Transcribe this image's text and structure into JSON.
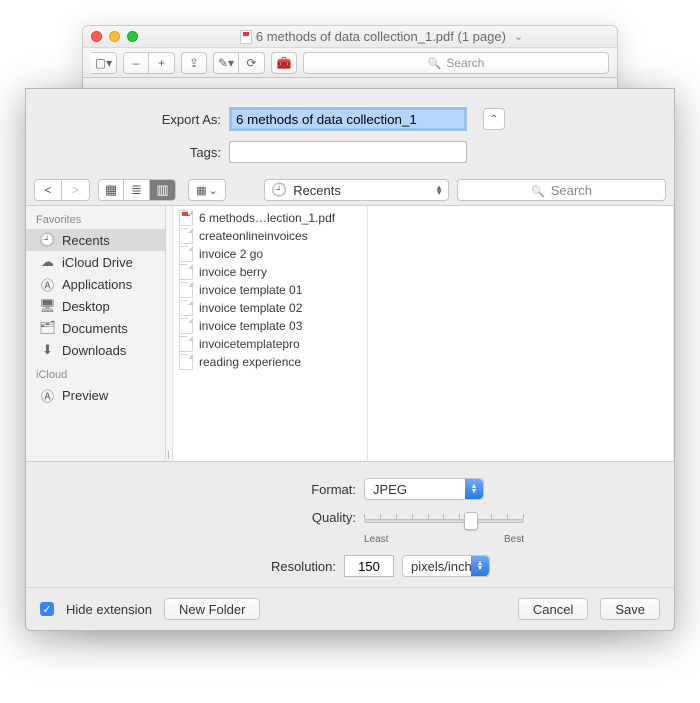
{
  "parent": {
    "title": "6 methods of data collection_1.pdf (1 page)",
    "search_placeholder": "Search"
  },
  "exportForm": {
    "exportLabel": "Export As:",
    "exportValue": "6 methods of data collection_1",
    "tagsLabel": "Tags:",
    "tagsValue": ""
  },
  "browser": {
    "locationLabel": "Recents",
    "searchLabel": "Search",
    "sidebar": {
      "favoritesHeader": "Favorites",
      "icloudHeader": "iCloud",
      "items": [
        {
          "icon": "clock",
          "label": "Recents",
          "selected": true
        },
        {
          "icon": "cloud",
          "label": "iCloud Drive"
        },
        {
          "icon": "apps",
          "label": "Applications"
        },
        {
          "icon": "desktop",
          "label": "Desktop"
        },
        {
          "icon": "doc",
          "label": "Documents"
        },
        {
          "icon": "down",
          "label": "Downloads"
        }
      ],
      "icloudItems": [
        {
          "icon": "apps",
          "label": "Preview"
        }
      ]
    },
    "files": [
      {
        "name": "6 methods…lection_1.pdf",
        "kind": "pdf"
      },
      {
        "name": "createonlineinvoices",
        "kind": "file"
      },
      {
        "name": "invoice 2 go",
        "kind": "file"
      },
      {
        "name": "invoice berry",
        "kind": "file"
      },
      {
        "name": "invoice template 01",
        "kind": "file"
      },
      {
        "name": "invoice template 02",
        "kind": "file"
      },
      {
        "name": "invoice template 03",
        "kind": "file"
      },
      {
        "name": "invoicetemplatepro",
        "kind": "file"
      },
      {
        "name": "reading experience",
        "kind": "file"
      }
    ]
  },
  "formatArea": {
    "formatLabel": "Format:",
    "formatValue": "JPEG",
    "qualityLabel": "Quality:",
    "qualityLeast": "Least",
    "qualityBest": "Best",
    "resolutionLabel": "Resolution:",
    "resolutionValue": "150",
    "resolutionUnit": "pixels/inch"
  },
  "bottomBar": {
    "hideExtension": "Hide extension",
    "newFolder": "New Folder",
    "cancel": "Cancel",
    "save": "Save"
  },
  "icons": {
    "clock": "🕘",
    "cloud": "☁︎",
    "apps": "Ⓐ",
    "desktop": "🖥",
    "doc": "🗂",
    "down": "⬇︎",
    "grid4": "▦",
    "list": "≣",
    "columns": "▥",
    "gear": "⚙"
  }
}
